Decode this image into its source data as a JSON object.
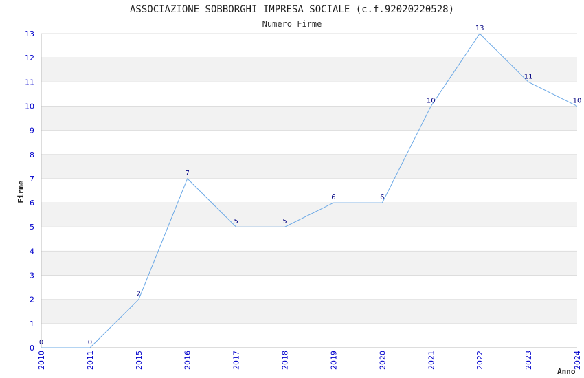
{
  "chart_data": {
    "type": "line",
    "title": "ASSOCIAZIONE SOBBORGHI IMPRESA SOCIALE (c.f.92020220528)",
    "subtitle": "Numero Firme",
    "xlabel": "Anno",
    "ylabel": "Firme",
    "categories": [
      "2010",
      "2011",
      "2015",
      "2016",
      "2017",
      "2018",
      "2019",
      "2020",
      "2021",
      "2022",
      "2023",
      "2024"
    ],
    "series": [
      {
        "values": [
          0,
          0,
          2,
          7,
          5,
          5,
          6,
          6,
          10,
          13,
          11,
          10
        ]
      }
    ],
    "ylim": [
      0,
      13
    ],
    "yticks": [
      0,
      1,
      2,
      3,
      4,
      5,
      6,
      7,
      8,
      9,
      10,
      11,
      12,
      13
    ],
    "grid": true,
    "colors": {
      "line": "#6aa8e6",
      "band": "#f2f2f2",
      "tick_text": "#0000cc",
      "data_label": "#000080"
    }
  }
}
